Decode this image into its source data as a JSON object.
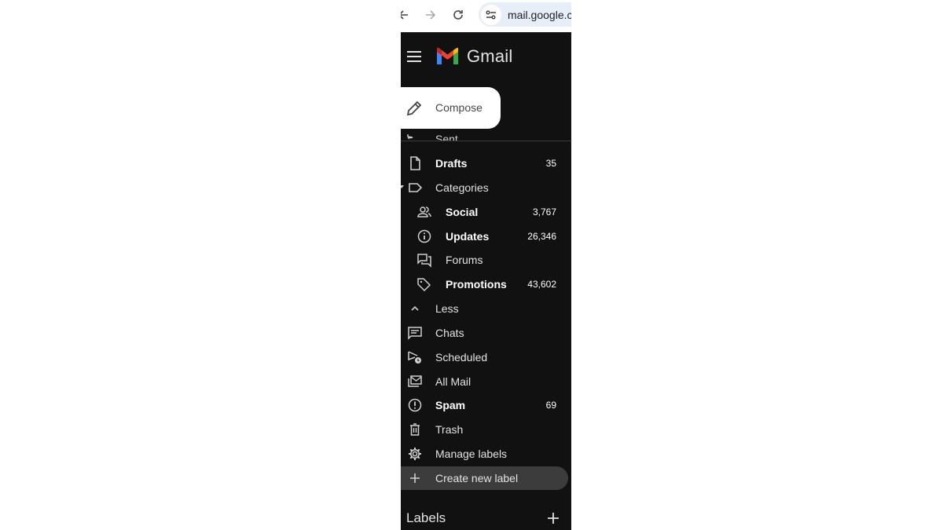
{
  "browser": {
    "url": "mail.google.com",
    "back_icon": "arrow-left-icon",
    "forward_icon": "arrow-right-icon",
    "reload_icon": "reload-icon",
    "site_settings_icon": "tune-icon"
  },
  "app": {
    "brand": "Gmail",
    "menu_icon": "hamburger-menu-icon",
    "logo_icon": "gmail-logo-icon"
  },
  "compose": {
    "label": "Compose",
    "icon": "pencil-icon"
  },
  "nav": {
    "sent_partial": "Sent",
    "items": [
      {
        "label": "Drafts",
        "count": "35",
        "icon": "draft-file-icon",
        "bold": true
      },
      {
        "label": "Categories",
        "count": "",
        "icon": "label-outline-icon",
        "bold": false,
        "expanded": true
      },
      {
        "label": "Social",
        "count": "3,767",
        "icon": "people-icon",
        "bold": true
      },
      {
        "label": "Updates",
        "count": "26,346",
        "icon": "info-icon",
        "bold": true
      },
      {
        "label": "Forums",
        "count": "",
        "icon": "forum-icon",
        "bold": false
      },
      {
        "label": "Promotions",
        "count": "43,602",
        "icon": "tag-icon",
        "bold": true
      },
      {
        "label": "Less",
        "count": "",
        "icon": "chevron-up-icon",
        "bold": false
      },
      {
        "label": "Chats",
        "count": "",
        "icon": "chat-icon",
        "bold": false
      },
      {
        "label": "Scheduled",
        "count": "",
        "icon": "scheduled-send-icon",
        "bold": false
      },
      {
        "label": "All Mail",
        "count": "",
        "icon": "all-mail-icon",
        "bold": false
      },
      {
        "label": "Spam",
        "count": "69",
        "icon": "spam-icon",
        "bold": true
      },
      {
        "label": "Trash",
        "count": "",
        "icon": "trash-icon",
        "bold": false
      },
      {
        "label": "Manage labels",
        "count": "",
        "icon": "gear-icon",
        "bold": false
      },
      {
        "label": "Create new label",
        "count": "",
        "icon": "plus-icon",
        "bold": false,
        "hovered": true
      }
    ]
  },
  "labels_section": {
    "title": "Labels",
    "add_icon": "plus-icon"
  },
  "colors": {
    "sidebar_bg": "#111111",
    "hover_bg": "#3c3c3c",
    "text": "#e3e3e3",
    "compose_bg": "#ffffff",
    "address_bg": "#e8eef7"
  }
}
